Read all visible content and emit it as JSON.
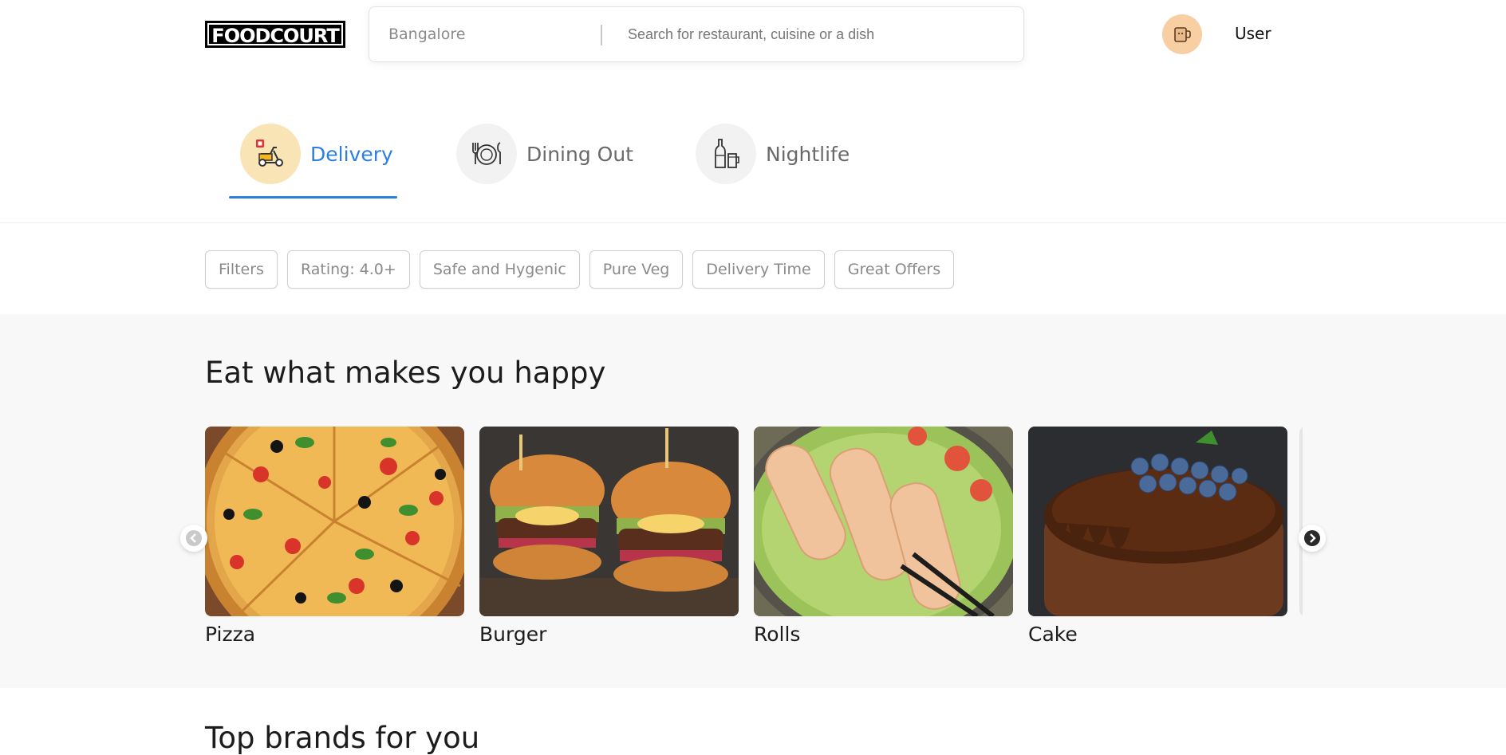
{
  "header": {
    "logo_text": "FOODCOURT",
    "location": "Bangalore",
    "search_placeholder": "Search for restaurant, cuisine or a dish",
    "user_label": "User",
    "avatar_icon": "mug-avatar-icon"
  },
  "tabs": [
    {
      "label": "Delivery",
      "icon": "scooter-icon",
      "active": true
    },
    {
      "label": "Dining Out",
      "icon": "plate-cutlery-icon",
      "active": false
    },
    {
      "label": "Nightlife",
      "icon": "bottle-glass-icon",
      "active": false
    }
  ],
  "filters": [
    "Filters",
    "Rating: 4.0+",
    "Safe and Hygenic",
    "Pure Veg",
    "Delivery Time",
    "Great Offers"
  ],
  "happy": {
    "title": "Eat what makes you happy",
    "items": [
      {
        "label": "Pizza"
      },
      {
        "label": "Burger"
      },
      {
        "label": "Rolls"
      },
      {
        "label": "Cake"
      }
    ]
  },
  "brands": {
    "title": "Top brands for you"
  },
  "colors": {
    "accent": "#2d7fde",
    "active_tab_bg": "#f9e4b6",
    "avatar_bg": "#f7cfa3",
    "section_bg": "#f8f8f8"
  }
}
